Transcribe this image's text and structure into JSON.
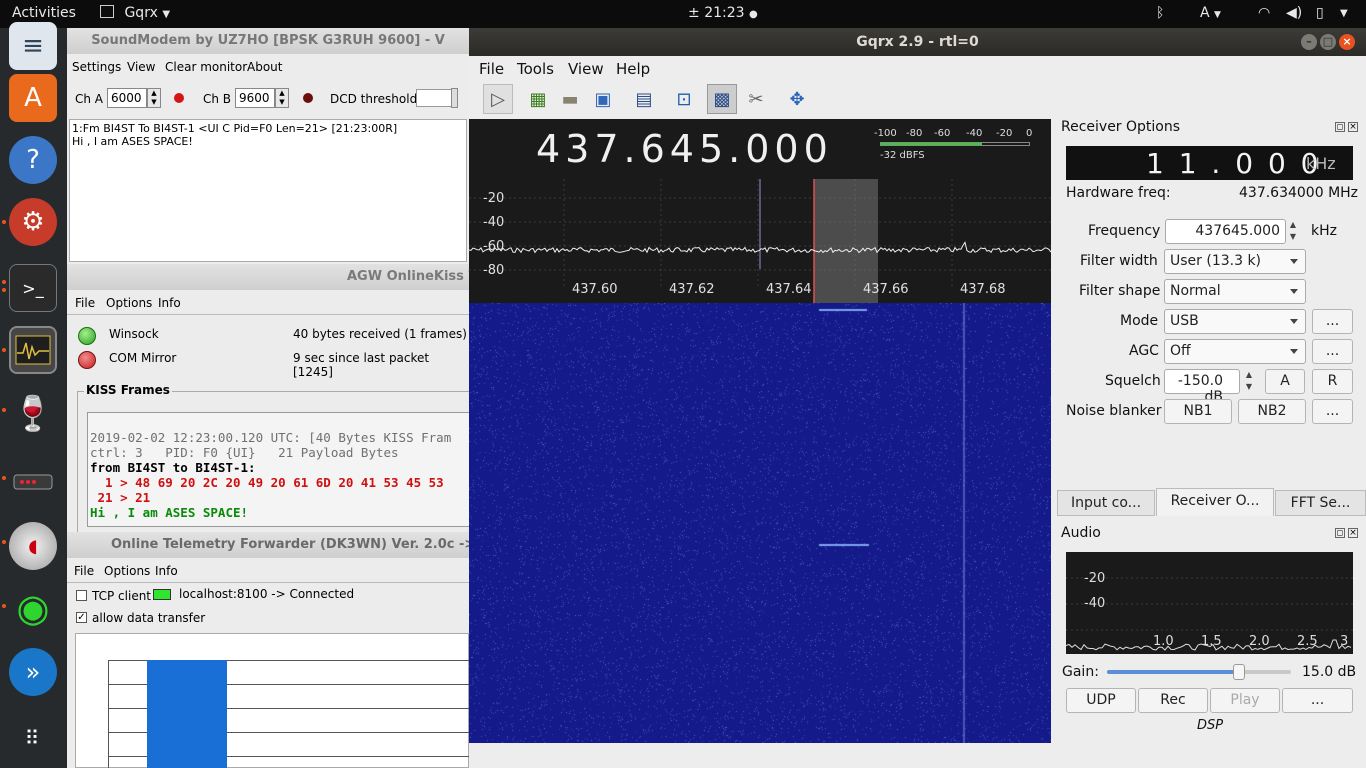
{
  "topbar": {
    "activities": "Activities",
    "app_name": "Gqrx",
    "clock": "21:23",
    "lang": "A"
  },
  "soundmodem": {
    "title": "SoundModem by UZ7HO [BPSK G3RUH 9600] - V",
    "menu": [
      "Settings",
      "View",
      "Clear monitor",
      "About"
    ],
    "cha_label": "Ch A",
    "cha_value": "6000",
    "chb_label": "Ch B",
    "chb_value": "9600",
    "dcd_label": "DCD threshold",
    "log_lines": [
      "1:Fm BI4ST To BI4ST-1 <UI C Pid=F0 Len=21> [21:23:00R]",
      "Hi , I am ASES SPACE!"
    ]
  },
  "agw": {
    "title": "AGW OnlineKiss V",
    "menu": [
      "File",
      "Options",
      "Info"
    ],
    "winsock_label": "Winsock",
    "winsock_status": "40 bytes received (1 frames)",
    "com_label": "COM Mirror",
    "com_status": "9 sec since last packet [1245]",
    "kiss_group_label": "KISS Frames",
    "kiss_lines": [
      "2019-02-02 12:23:00.120 UTC: [40 Bytes KISS Fram",
      "ctrl: 3   PID: F0 {UI}   21 Payload Bytes",
      "from BI4ST to BI4ST-1:",
      "  1 > 48 69 20 2C 20 49 20 61 6D 20 41 53 45 53",
      " 21 > 21",
      "Hi , I am ASES SPACE!"
    ]
  },
  "telemetry": {
    "title": "Online Telemetry Forwarder (DK3WN) Ver. 2.0c ->",
    "menu": [
      "File",
      "Options",
      "Info"
    ],
    "tcp_label": "TCP client",
    "conn_status": "localhost:8100 -> Connected",
    "allow_label": "allow data transfer",
    "allow_check": "✓"
  },
  "gqrx": {
    "title": "Gqrx 2.9 - rtl=0",
    "menu": [
      "File",
      "Tools",
      "View",
      "Help"
    ],
    "frequency_display": "437.645.000",
    "meter_scale": [
      "-100",
      "-80",
      "-60",
      "-40",
      "-20",
      "0"
    ],
    "meter_readout": "-32 dBFS",
    "y_ticks": [
      "-20",
      "-40",
      "-60",
      "-80"
    ],
    "x_ticks": [
      "437.60",
      "437.62",
      "437.64",
      "437.66",
      "437.68"
    ],
    "receiver": {
      "panel_title": "Receiver Options",
      "offset_display": "1 1 . 0 0 0",
      "offset_unit": "kHz",
      "hw_label": "Hardware freq:",
      "hw_value": "437.634000 MHz",
      "freq_label": "Frequency",
      "freq_value": "437645.000",
      "freq_unit": "kHz",
      "filter_width_label": "Filter width",
      "filter_width_value": "User (13.3 k)",
      "filter_shape_label": "Filter shape",
      "filter_shape_value": "Normal",
      "mode_label": "Mode",
      "mode_value": "USB",
      "agc_label": "AGC",
      "agc_value": "Off",
      "squelch_label": "Squelch",
      "squelch_value": "-150.0 dB",
      "squelch_a": "A",
      "squelch_r": "R",
      "nb_label": "Noise blanker",
      "nb1": "NB1",
      "nb2": "NB2",
      "more": "..."
    },
    "tabs": [
      "Input co...",
      "Receiver O...",
      "FFT Se..."
    ],
    "audio": {
      "panel_title": "Audio",
      "y_ticks": [
        "-20",
        "-40"
      ],
      "x_ticks": [
        "1.0",
        "1.5",
        "2.0",
        "2.5",
        "3"
      ],
      "gain_label": "Gain:",
      "gain_value": "15.0 dB",
      "gain_level": 0.72,
      "udp": "UDP",
      "rec": "Rec",
      "play": "Play",
      "more": "...",
      "dsp": "DSP"
    }
  }
}
